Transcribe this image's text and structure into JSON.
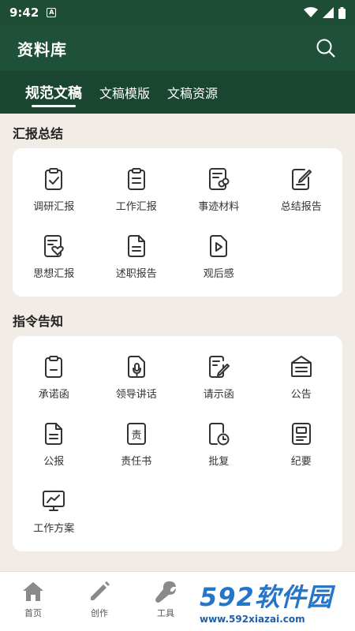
{
  "status": {
    "time": "9:42",
    "notif": "A"
  },
  "app": {
    "title": "资料库"
  },
  "tabs": [
    {
      "label": "规范文稿",
      "active": true
    },
    {
      "label": "文稿模版",
      "active": false
    },
    {
      "label": "文稿资源",
      "active": false
    }
  ],
  "sections": [
    {
      "title": "汇报总结",
      "items": [
        {
          "label": "调研汇报",
          "icon": "clipboard-check-icon"
        },
        {
          "label": "工作汇报",
          "icon": "clipboard-list-icon"
        },
        {
          "label": "事迹材料",
          "icon": "document-link-icon"
        },
        {
          "label": "总结报告",
          "icon": "document-edit-icon"
        },
        {
          "label": "思想汇报",
          "icon": "document-heart-icon"
        },
        {
          "label": "述职报告",
          "icon": "document-lines-icon"
        },
        {
          "label": "观后感",
          "icon": "document-play-icon"
        }
      ]
    },
    {
      "title": "指令告知",
      "items": [
        {
          "label": "承诺函",
          "icon": "clipboard-blank-icon"
        },
        {
          "label": "领导讲话",
          "icon": "document-mic-icon"
        },
        {
          "label": "请示函",
          "icon": "document-pen-icon"
        },
        {
          "label": "公告",
          "icon": "announcement-icon"
        },
        {
          "label": "公报",
          "icon": "document-lines-icon"
        },
        {
          "label": "责任书",
          "icon": "responsibility-doc-icon"
        },
        {
          "label": "批复",
          "icon": "document-clock-icon"
        },
        {
          "label": "纪要",
          "icon": "document-list-icon"
        },
        {
          "label": "工作方案",
          "icon": "monitor-chart-icon"
        }
      ]
    }
  ],
  "icon_glyph": {
    "responsibility": "责"
  },
  "bottom_nav": [
    {
      "label": "首页"
    },
    {
      "label": "创作"
    },
    {
      "label": "工具"
    }
  ],
  "watermark": {
    "logo": "592软件园",
    "url": "www.592xiazai.com"
  },
  "colors": {
    "header": "#1f5039",
    "tabbar": "#1a4531",
    "background": "#f1ede6",
    "accent": "#2576c9"
  }
}
